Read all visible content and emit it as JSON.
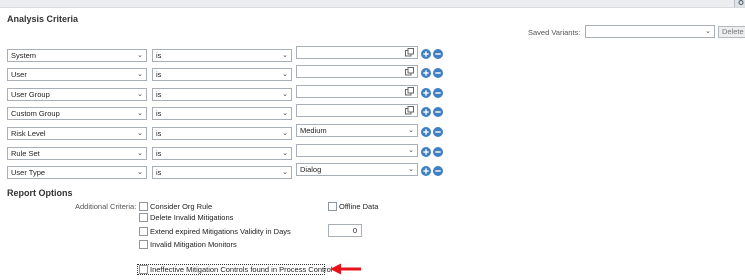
{
  "analysis": {
    "title": "Analysis Criteria",
    "saved_variants_label": "Saved Variants:",
    "delete_label": "Delete",
    "rows": [
      {
        "field": "System",
        "op": "is",
        "value": "",
        "value_type": "text"
      },
      {
        "field": "User",
        "op": "is",
        "value": "",
        "value_type": "text"
      },
      {
        "field": "User Group",
        "op": "is",
        "value": "",
        "value_type": "text"
      },
      {
        "field": "Custom Group",
        "op": "is",
        "value": "",
        "value_type": "text"
      },
      {
        "field": "Risk Level",
        "op": "is",
        "value": "Medium",
        "value_type": "select"
      },
      {
        "field": "Rule Set",
        "op": "is",
        "value": "",
        "value_type": "select"
      },
      {
        "field": "User Type",
        "op": "is",
        "value": "Dialog",
        "value_type": "select"
      }
    ]
  },
  "report": {
    "title": "Report Options",
    "additional_criteria_label": "Additional Criteria:",
    "options": {
      "consider_org_rule": "Consider Org Rule",
      "offline_data": "Offline Data",
      "delete_invalid_mitigations": "Delete Invalid Mitigations",
      "extend_expired": "Extend expired Mitigations Validity in Days",
      "extend_days_value": "0",
      "invalid_monitors": "Invalid Mitigation Monitors",
      "ineffective_controls": "Ineffective Mitigation Controls found in Process Control"
    }
  },
  "colors": {
    "add_button": "#3f7fc2",
    "remove_button": "#3f7fc2",
    "annotation_arrow": "#e8121b"
  },
  "icons": {
    "add": "plus-circle-icon",
    "remove": "minus-circle-icon",
    "multi_select": "copy-icon",
    "dropdown": "chevron-down-icon"
  }
}
